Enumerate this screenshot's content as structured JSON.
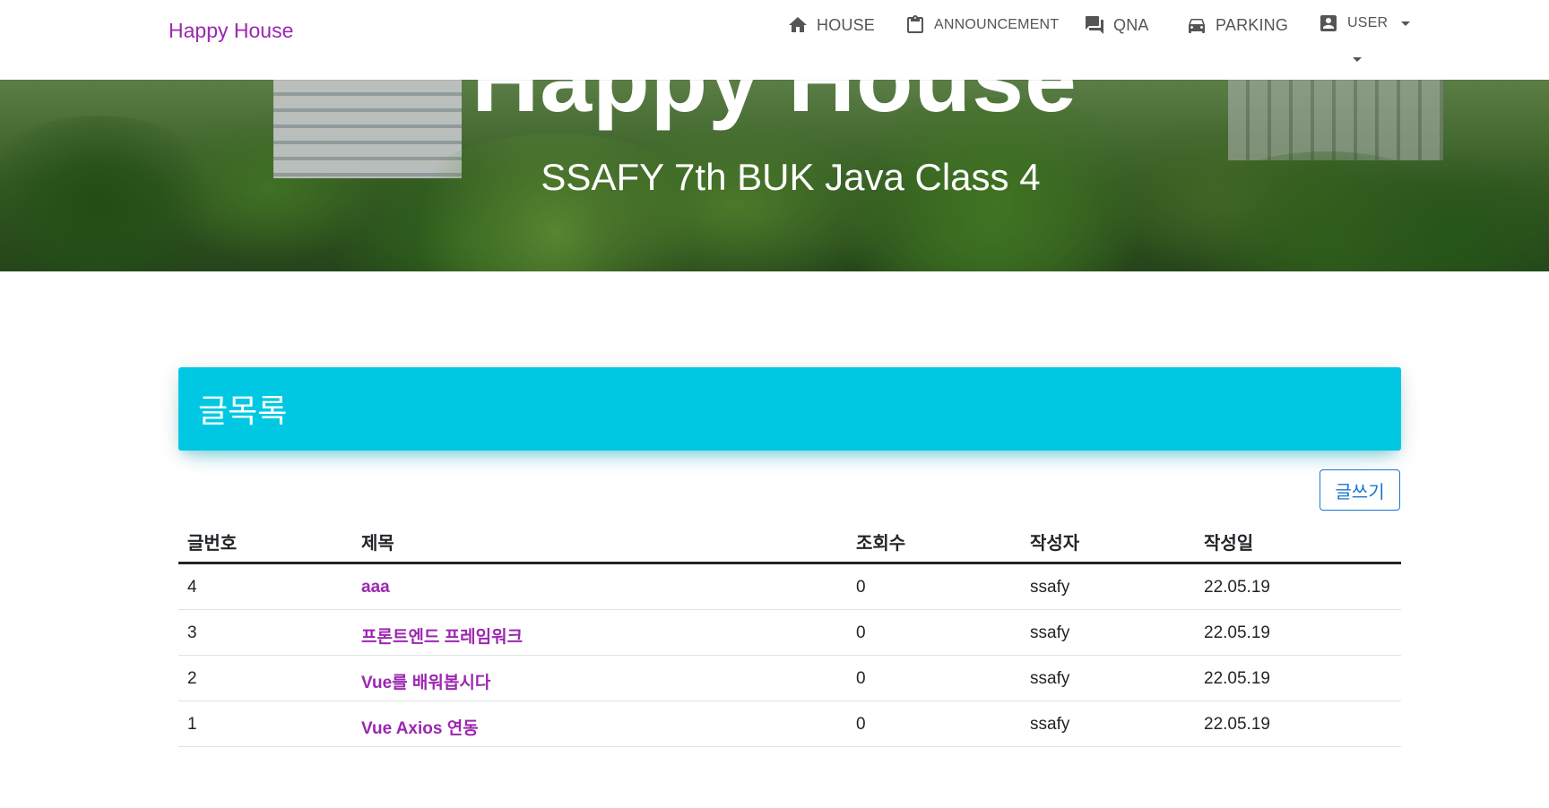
{
  "navbar": {
    "brand": "Happy House",
    "items": [
      {
        "label": "HOUSE",
        "icon": "home-icon"
      },
      {
        "label": "ANNOUNCEMENT",
        "icon": "clipboard-icon"
      },
      {
        "label": "QNA",
        "icon": "chat-icon"
      },
      {
        "label": "PARKING",
        "icon": "car-icon"
      },
      {
        "label": "USER",
        "icon": "account-box-icon"
      }
    ]
  },
  "hero": {
    "title": "Happy House",
    "subtitle": "SSAFY 7th BUK Java Class 4"
  },
  "board": {
    "title": "글목록",
    "write_button": "글쓰기",
    "columns": [
      "글번호",
      "제목",
      "조회수",
      "작성자",
      "작성일"
    ],
    "rows": [
      {
        "no": "4",
        "title": "aaa",
        "views": "0",
        "author": "ssafy",
        "date": "22.05.19"
      },
      {
        "no": "3",
        "title": "프론트엔드 프레임워크",
        "views": "0",
        "author": "ssafy",
        "date": "22.05.19"
      },
      {
        "no": "2",
        "title": "Vue를 배워봅시다",
        "views": "0",
        "author": "ssafy",
        "date": "22.05.19"
      },
      {
        "no": "1",
        "title": "Vue Axios 연동",
        "views": "0",
        "author": "ssafy",
        "date": "22.05.19"
      }
    ]
  },
  "colors": {
    "brand": "#9c27b0",
    "header_bg": "#00c8e3",
    "button_outline": "#1976d2"
  }
}
